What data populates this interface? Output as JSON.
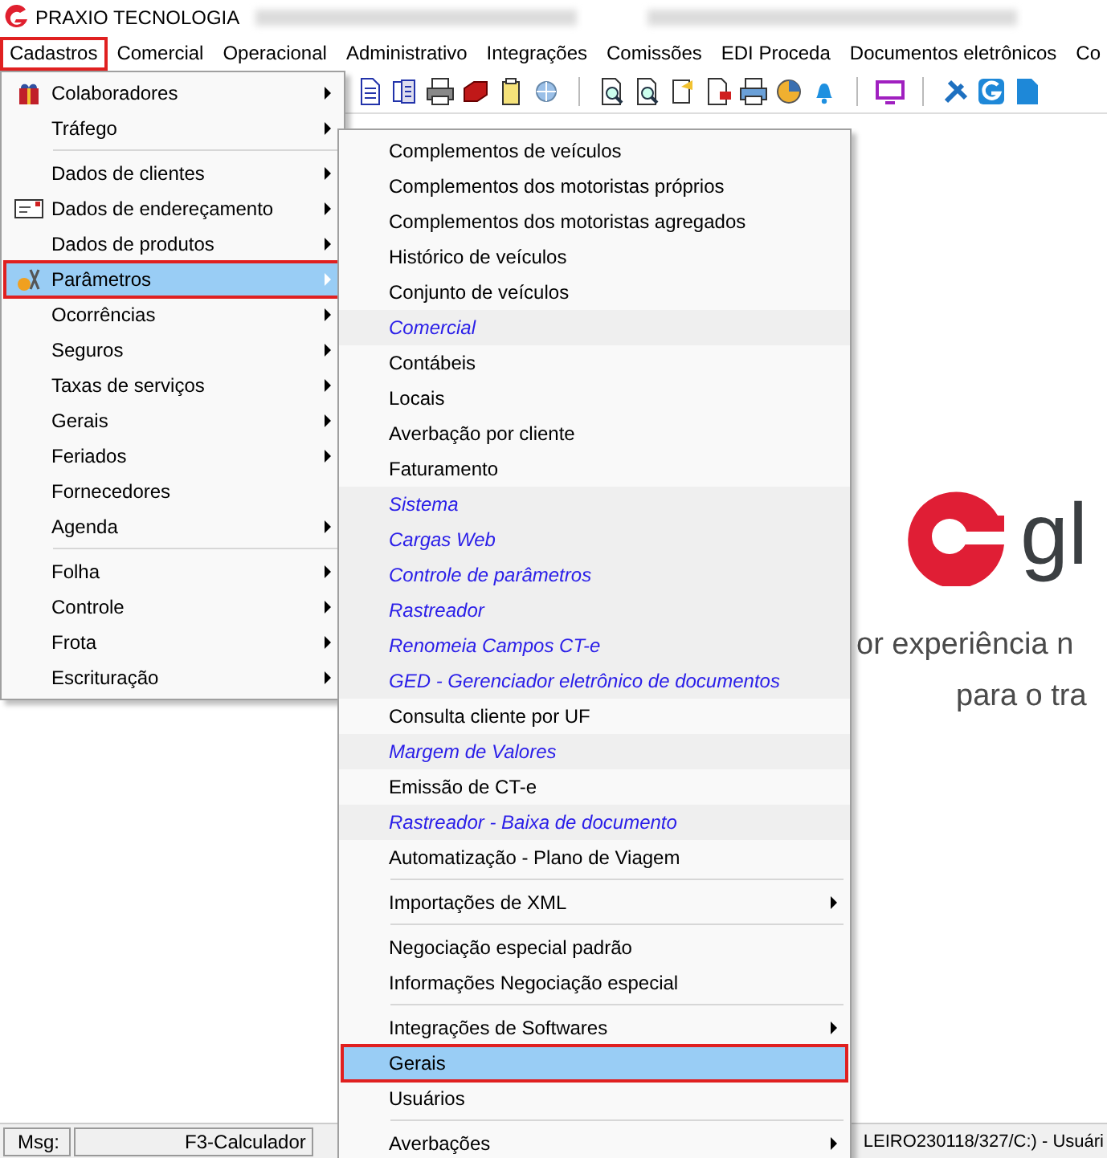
{
  "window": {
    "title": "PRAXIO TECNOLOGIA"
  },
  "menubar": [
    {
      "label": "Cadastros",
      "selected": true
    },
    {
      "label": "Comercial",
      "selected": false
    },
    {
      "label": "Operacional",
      "selected": false
    },
    {
      "label": "Administrativo",
      "selected": false
    },
    {
      "label": "Integrações",
      "selected": false
    },
    {
      "label": "Comissões",
      "selected": false
    },
    {
      "label": "EDI Proceda",
      "selected": false
    },
    {
      "label": "Documentos eletrônicos",
      "selected": false
    },
    {
      "label": "Co",
      "selected": false
    }
  ],
  "menu": [
    {
      "kind": "item",
      "label": "Colaboradores",
      "submenu": true,
      "selected": false
    },
    {
      "kind": "item",
      "label": "Tráfego",
      "submenu": true,
      "selected": false
    },
    {
      "kind": "separator"
    },
    {
      "kind": "item",
      "label": "Dados de clientes",
      "submenu": true,
      "selected": false
    },
    {
      "kind": "item",
      "label": "Dados de endereçamento",
      "submenu": true,
      "selected": false
    },
    {
      "kind": "item",
      "label": "Dados de produtos",
      "submenu": true,
      "selected": false
    },
    {
      "kind": "item",
      "label": "Parâmetros",
      "submenu": true,
      "selected": true
    },
    {
      "kind": "item",
      "label": "Ocorrências",
      "submenu": true,
      "selected": false
    },
    {
      "kind": "item",
      "label": "Seguros",
      "submenu": true,
      "selected": false
    },
    {
      "kind": "item",
      "label": "Taxas de serviços",
      "submenu": true,
      "selected": false
    },
    {
      "kind": "item",
      "label": "Gerais",
      "submenu": true,
      "selected": false
    },
    {
      "kind": "item",
      "label": "Feriados",
      "submenu": true,
      "selected": false
    },
    {
      "kind": "item",
      "label": "Fornecedores",
      "submenu": false,
      "selected": false
    },
    {
      "kind": "item",
      "label": "Agenda",
      "submenu": true,
      "selected": false
    },
    {
      "kind": "separator"
    },
    {
      "kind": "item",
      "label": "Folha",
      "submenu": true,
      "selected": false
    },
    {
      "kind": "item",
      "label": "Controle",
      "submenu": true,
      "selected": false
    },
    {
      "kind": "item",
      "label": "Frota",
      "submenu": true,
      "selected": false
    },
    {
      "kind": "item",
      "label": "Escrituração",
      "submenu": true,
      "selected": false
    }
  ],
  "submenu": [
    {
      "kind": "item",
      "label": "Complementos de veículos",
      "submenu": false,
      "selected": false
    },
    {
      "kind": "item",
      "label": "Complementos dos motoristas próprios",
      "submenu": false,
      "selected": false
    },
    {
      "kind": "item",
      "label": "Complementos dos motoristas agregados",
      "submenu": false,
      "selected": false
    },
    {
      "kind": "item",
      "label": "Histórico de veículos",
      "submenu": false,
      "selected": false
    },
    {
      "kind": "item",
      "label": "Conjunto de veículos",
      "submenu": false,
      "selected": false
    },
    {
      "kind": "italic",
      "label": "Comercial",
      "submenu": false,
      "selected": false
    },
    {
      "kind": "item",
      "label": "Contábeis",
      "submenu": false,
      "selected": false
    },
    {
      "kind": "item",
      "label": "Locais",
      "submenu": false,
      "selected": false
    },
    {
      "kind": "item",
      "label": "Averbação por cliente",
      "submenu": false,
      "selected": false
    },
    {
      "kind": "item",
      "label": "Faturamento",
      "submenu": false,
      "selected": false
    },
    {
      "kind": "italic",
      "label": "Sistema",
      "submenu": false,
      "selected": false
    },
    {
      "kind": "italic",
      "label": "Cargas Web",
      "submenu": false,
      "selected": false
    },
    {
      "kind": "italic",
      "label": "Controle de parâmetros",
      "submenu": false,
      "selected": false
    },
    {
      "kind": "italic",
      "label": "Rastreador",
      "submenu": false,
      "selected": false
    },
    {
      "kind": "italic",
      "label": "Renomeia Campos CT-e",
      "submenu": false,
      "selected": false
    },
    {
      "kind": "italic",
      "label": "GED - Gerenciador eletrônico de documentos",
      "submenu": false,
      "selected": false
    },
    {
      "kind": "item",
      "label": "Consulta cliente por UF",
      "submenu": false,
      "selected": false
    },
    {
      "kind": "italic",
      "label": "Margem de Valores",
      "submenu": false,
      "selected": false
    },
    {
      "kind": "item",
      "label": "Emissão de CT-e",
      "submenu": false,
      "selected": false
    },
    {
      "kind": "italic",
      "label": "Rastreador - Baixa de documento",
      "submenu": false,
      "selected": false
    },
    {
      "kind": "item",
      "label": "Automatização - Plano de Viagem",
      "submenu": false,
      "selected": false
    },
    {
      "kind": "separator"
    },
    {
      "kind": "item",
      "label": "Importações de XML",
      "submenu": true,
      "selected": false
    },
    {
      "kind": "separator"
    },
    {
      "kind": "item",
      "label": "Negociação especial padrão",
      "submenu": false,
      "selected": false
    },
    {
      "kind": "item",
      "label": "Informações Negociação especial",
      "submenu": false,
      "selected": false
    },
    {
      "kind": "separator"
    },
    {
      "kind": "item",
      "label": "Integrações de Softwares",
      "submenu": true,
      "selected": false
    },
    {
      "kind": "item",
      "label": "Gerais",
      "submenu": false,
      "selected": true
    },
    {
      "kind": "item",
      "label": "Usuários",
      "submenu": false,
      "selected": false
    },
    {
      "kind": "separator"
    },
    {
      "kind": "item",
      "label": "Averbações",
      "submenu": true,
      "selected": false
    }
  ],
  "splash": {
    "brand": "gl",
    "tagline_1": "or experiência n",
    "tagline_2": "para o tra"
  },
  "status_bar": {
    "msg_label": "Msg:",
    "hint": "F3-Calculador",
    "info": "LEIRO230118/327/C:) - Usuári"
  }
}
